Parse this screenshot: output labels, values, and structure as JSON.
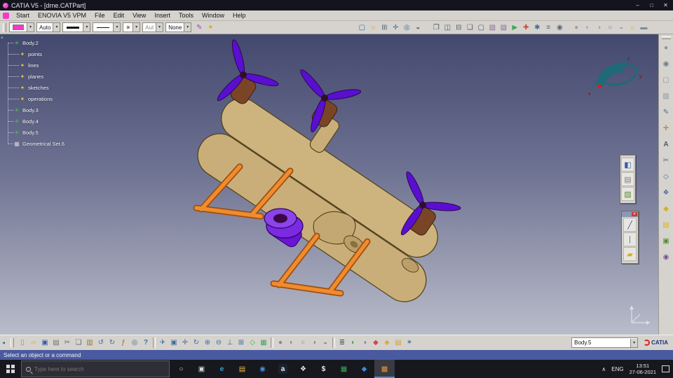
{
  "colors": {
    "accent_magenta": "#f838c8",
    "viewport_top": "#43486e",
    "viewport_bottom": "#b9bcc9",
    "model_body_tan": "#cdb37e",
    "model_propeller_purple": "#5a0fd0",
    "model_motor_brown": "#7a4526",
    "model_center_purple": "#7a2ae0",
    "model_skid_orange": "#ef8c2e",
    "compass_teal": "#1d6b79",
    "status_bar_blue": "#4a5aa0",
    "taskbar_dark": "#17181d"
  },
  "window": {
    "title": "CATIA V5 - [drne.CATPart]",
    "buttons": [
      {
        "name": "minimize-button",
        "glyph": "–"
      },
      {
        "name": "maximize-button",
        "glyph": "□"
      },
      {
        "name": "close-button",
        "glyph": "✕"
      }
    ]
  },
  "ui": {
    "drop_arrow": "▾",
    "overflow_left": "◂",
    "tree_scroll_up": "▴",
    "tray_chevron": "∧"
  },
  "menubar": {
    "items": [
      {
        "name": "menu-start",
        "label": "Start"
      },
      {
        "name": "menu-enovia",
        "label": "ENOVIA V5 VPM"
      },
      {
        "name": "menu-file",
        "label": "File"
      },
      {
        "name": "menu-edit",
        "label": "Edit"
      },
      {
        "name": "menu-view",
        "label": "View"
      },
      {
        "name": "menu-insert",
        "label": "Insert"
      },
      {
        "name": "menu-tools",
        "label": "Tools"
      },
      {
        "name": "menu-window",
        "label": "Window"
      },
      {
        "name": "menu-help",
        "label": "Help"
      }
    ]
  },
  "props_toolbar": {
    "opacity": "Auto",
    "point_symbol": "✳",
    "render_style": "Aut",
    "layer": "None"
  },
  "toolbars": {
    "controls_icons": [
      {
        "name": "painter-icon",
        "glyph": "✎",
        "style": "color:#b03ac8"
      },
      {
        "name": "wizard-icon",
        "glyph": "✶",
        "style": "color:#d8a020"
      }
    ],
    "top_b": [
      {
        "name": "camera-icon",
        "glyph": "▢",
        "style": "color:#3a6ea5"
      },
      {
        "name": "light-icon",
        "glyph": "☼",
        "style": "color:#d8a020"
      },
      {
        "name": "grid-icon",
        "glyph": "⊞",
        "style": "color:#56687a"
      },
      {
        "name": "snap-icon",
        "glyph": "✛",
        "style": "color:#3a6ea5"
      },
      {
        "name": "magnifier-icon",
        "glyph": "◎",
        "style": "color:#3a6ea5"
      },
      {
        "name": "depth-effect-icon",
        "glyph": "◒",
        "style": "color:#56687a"
      }
    ],
    "top_c": [
      {
        "name": "new-window-icon",
        "glyph": "❐",
        "style": "color:#4a5a6a"
      },
      {
        "name": "tile-horizontal-icon",
        "glyph": "◫",
        "style": "color:#4a5a6a"
      },
      {
        "name": "tile-vertical-icon",
        "glyph": "⊟",
        "style": "color:#4a5a6a"
      },
      {
        "name": "cascade-icon",
        "glyph": "❏",
        "style": "color:#4a5a6a"
      },
      {
        "name": "full-screen-icon",
        "glyph": "▢",
        "style": "color:#4a5a6a"
      },
      {
        "name": "capture-icon",
        "glyph": "▧",
        "style": "color:#8a6d9a"
      },
      {
        "name": "album-icon",
        "glyph": "▨",
        "style": "color:#8a6d9a"
      },
      {
        "name": "macro-play-icon",
        "glyph": "▶",
        "style": "color:#3aa85a"
      },
      {
        "name": "customize-icon",
        "glyph": "✚",
        "style": "color:#c84a3a"
      },
      {
        "name": "options-icon",
        "glyph": "✱",
        "style": "color:#3a6ea5"
      },
      {
        "name": "standards-icon",
        "glyph": "≡",
        "style": "color:#56687a"
      },
      {
        "name": "visualization-icon",
        "glyph": "◉",
        "style": "color:#56687a"
      }
    ],
    "top_d": [
      {
        "name": "shading-icon",
        "glyph": "●",
        "style": "color:#95a2b5"
      },
      {
        "name": "shading-edges-icon",
        "glyph": "◐",
        "style": "color:#95a2b5"
      },
      {
        "name": "shading-hidden-edges-icon",
        "glyph": "◑",
        "style": "color:#95a2b5"
      },
      {
        "name": "wireframe-icon",
        "glyph": "○",
        "style": "color:#6a7a90"
      },
      {
        "name": "custom-view-mode-icon",
        "glyph": "◒",
        "style": "color:#95a2b5"
      },
      {
        "name": "lighting-icon",
        "glyph": "☼",
        "style": "color:#d8b020"
      },
      {
        "name": "ground-icon",
        "glyph": "▬",
        "style": "color:#7a8a9a"
      }
    ],
    "right_col": [
      {
        "name": "part-body-icon",
        "glyph": "●",
        "style": "color:#8a929c"
      },
      {
        "name": "sphere-tool-icon",
        "glyph": "◉",
        "style": "color:#6a7a8a"
      },
      {
        "name": "pad-icon",
        "glyph": "▢",
        "style": "color:#8a929c"
      },
      {
        "name": "pocket-icon",
        "glyph": "▥",
        "style": "color:#8a929c"
      },
      {
        "name": "sketcher-icon",
        "glyph": "✎",
        "style": "color:#4a6a9a"
      },
      {
        "name": "measure-icon",
        "glyph": "✛",
        "style": "color:#9a7a2a"
      },
      {
        "name": "annotation-icon",
        "glyph": "A",
        "style": "color:#4a5a6a;font-weight:bold"
      },
      {
        "name": "trim-icon",
        "glyph": "✂",
        "style": "color:#5a6a7a"
      },
      {
        "name": "plane-icon",
        "glyph": "◇",
        "style": "color:#4a6a9a"
      },
      {
        "name": "pattern-icon",
        "glyph": "❖",
        "style": "color:#4a6a9a"
      },
      {
        "name": "apply-material-icon",
        "glyph": "◆",
        "style": "color:#d8b020"
      },
      {
        "name": "catalog-icon",
        "glyph": "▤",
        "style": "color:#d8b020"
      },
      {
        "name": "render-tool-icon",
        "glyph": "▣",
        "style": "color:#5a8a3a"
      },
      {
        "name": "camera-tool-icon",
        "glyph": "◉",
        "style": "color:#7a4a9a"
      }
    ],
    "panel_a": [
      {
        "name": "panel-view-icon",
        "glyph": "◧",
        "style": "color:#3a5aa8"
      },
      {
        "name": "panel-sheet-icon",
        "glyph": "▤",
        "style": "color:#7a828a"
      },
      {
        "name": "panel-image-icon",
        "glyph": "▨",
        "style": "color:#5a8a3a"
      }
    ],
    "panel_b": [
      {
        "name": "line-tool-icon",
        "glyph": "╱",
        "style": "color:#3a5aa8"
      },
      {
        "name": "axis-tool-icon",
        "glyph": "|",
        "style": "color:#6a727a"
      },
      {
        "name": "plane-tool-icon",
        "glyph": "▰",
        "style": "color:#d8b020"
      }
    ],
    "bottom_a": [
      {
        "name": "new-document-icon",
        "glyph": "▯",
        "style": "color:#8a929a"
      },
      {
        "name": "open-icon",
        "glyph": "▱",
        "style": "color:#d8a838"
      },
      {
        "name": "save-icon",
        "glyph": "▣",
        "style": "color:#3a5aa8"
      },
      {
        "name": "print-icon",
        "glyph": "▤",
        "style": "color:#6a727a"
      },
      {
        "name": "cut-icon",
        "glyph": "✂",
        "style": "color:#5a6a7a"
      },
      {
        "name": "copy-icon",
        "glyph": "❏",
        "style": "color:#5a6a7a"
      },
      {
        "name": "paste-icon",
        "glyph": "▥",
        "style": "color:#8a7a3a"
      },
      {
        "name": "undo-icon",
        "glyph": "↺",
        "style": "color:#3a6ea5"
      },
      {
        "name": "redo-icon",
        "glyph": "↻",
        "style": "color:#3a6ea5"
      },
      {
        "name": "formula-icon",
        "glyph": "ƒ",
        "style": "color:#8a6d1f"
      },
      {
        "name": "search-icon",
        "glyph": "◎",
        "style": "color:#3a6ea5"
      },
      {
        "name": "help-icon",
        "glyph": "?",
        "style": "color:#3a6ea5;font-weight:bold"
      }
    ],
    "bottom_b": [
      {
        "name": "fly-mode-icon",
        "glyph": "✈",
        "style": "color:#3a6ea5"
      },
      {
        "name": "fit-all-icon",
        "glyph": "▣",
        "style": "color:#3a6ea5"
      },
      {
        "name": "pan-icon",
        "glyph": "✛",
        "style": "color:#3a6ea5"
      },
      {
        "name": "rotate-icon",
        "glyph": "↻",
        "style": "color:#3a6ea5"
      },
      {
        "name": "zoom-in-icon",
        "glyph": "⊕",
        "style": "color:#3a6ea5"
      },
      {
        "name": "zoom-out-icon",
        "glyph": "⊖",
        "style": "color:#3a6ea5"
      },
      {
        "name": "normal-view-icon",
        "glyph": "⊥",
        "style": "color:#3a6ea5"
      },
      {
        "name": "multi-view-icon",
        "glyph": "⊞",
        "style": "color:#3a6ea5"
      },
      {
        "name": "quick-view-icon",
        "glyph": "◇",
        "style": "color:#3aa85a"
      },
      {
        "name": "named-views-icon",
        "glyph": "▦",
        "style": "color:#3aa85a"
      }
    ],
    "bottom_c": [
      {
        "name": "shading-view-icon",
        "glyph": "●",
        "style": "color:#7a8aa0"
      },
      {
        "name": "shading-edges-view-icon",
        "glyph": "◐",
        "style": "color:#7a8aa0"
      },
      {
        "name": "wireframe-view-icon",
        "glyph": "○",
        "style": "color:#7a8aa0"
      },
      {
        "name": "hidden-line-view-icon",
        "glyph": "◑",
        "style": "color:#7a8aa0"
      },
      {
        "name": "material-view-icon",
        "glyph": "◒",
        "style": "color:#7a8aa0"
      }
    ],
    "bottom_d": [
      {
        "name": "graph-tree-icon",
        "glyph": "≣",
        "style": "color:#4a5a6a"
      },
      {
        "name": "hide-show-icon",
        "glyph": "◐",
        "style": "color:#3aa85a"
      },
      {
        "name": "swap-visible-space-icon",
        "glyph": "◑",
        "style": "color:#8a6dc8"
      },
      {
        "name": "datum-icon",
        "glyph": "◆",
        "style": "color:#c84a4a"
      },
      {
        "name": "lock-update-icon",
        "glyph": "◈",
        "style": "color:#d8a020"
      },
      {
        "name": "catalog-browser-icon",
        "glyph": "▤",
        "style": "color:#d8a020"
      },
      {
        "name": "knowledge-icon",
        "glyph": "✶",
        "style": "color:#3a6ea5"
      }
    ],
    "active_body": "Body.5",
    "brand": "CATIA"
  },
  "tree": {
    "items": [
      {
        "name": "tree-item-body-2",
        "label": "Body.2",
        "glyph": "✳",
        "style": "color:#45c84f",
        "depth": 1
      },
      {
        "name": "tree-item-points",
        "label": "points",
        "glyph": "✦",
        "style": "color:#e8c24a",
        "depth": 2
      },
      {
        "name": "tree-item-lines",
        "label": "lines",
        "glyph": "✦",
        "style": "color:#e8c24a",
        "depth": 2
      },
      {
        "name": "tree-item-planes",
        "label": "planes",
        "glyph": "✦",
        "style": "color:#e8c24a",
        "depth": 2
      },
      {
        "name": "tree-item-sketches",
        "label": "sketches",
        "glyph": "✦",
        "style": "color:#e8c24a",
        "depth": 2
      },
      {
        "name": "tree-item-operations",
        "label": "operations",
        "glyph": "✦",
        "style": "color:#e8c24a",
        "depth": 2
      },
      {
        "name": "tree-item-body-3",
        "label": "Body.3",
        "glyph": "✳",
        "style": "color:#45c84f",
        "depth": 1
      },
      {
        "name": "tree-item-body-4",
        "label": "Body.4",
        "glyph": "✳",
        "style": "color:#45c84f",
        "depth": 1
      },
      {
        "name": "tree-item-body-5",
        "label": "Body.5",
        "glyph": "✳",
        "style": "color:#45c84f",
        "depth": 1
      },
      {
        "name": "tree-item-geometrical-set-6",
        "label": "Geometrical Set.6",
        "glyph": "▦",
        "style": "color:#cdd1da",
        "depth": 1
      }
    ]
  },
  "compass": {
    "axis_x": "x",
    "axis_y": "y",
    "axis_z": "z"
  },
  "statusbar": {
    "message": "Select an object or a command"
  },
  "taskbar": {
    "search_placeholder": "Type here to search",
    "apps": [
      {
        "name": "taskbar-cortana",
        "glyph": "○",
        "style": "color:#cfd4dc"
      },
      {
        "name": "taskbar-task-view",
        "glyph": "▣",
        "style": "color:#cfd4dc"
      },
      {
        "name": "taskbar-edge",
        "glyph": "e",
        "style": "color:#35a0e0;font-weight:bold"
      },
      {
        "name": "taskbar-file-explorer",
        "glyph": "▤",
        "style": "color:#e8b84a"
      },
      {
        "name": "taskbar-browser",
        "glyph": "◉",
        "style": "color:#4a90d9"
      },
      {
        "name": "taskbar-amazon",
        "glyph": "a",
        "style": "color:#f0f0f0;background:#1a2430;padding:0 3px;font-weight:bold"
      },
      {
        "name": "taskbar-dropbox",
        "glyph": "❖",
        "style": "color:#e8eaee"
      },
      {
        "name": "taskbar-payments",
        "glyph": "$",
        "style": "color:#e8eaee;font-weight:bold"
      },
      {
        "name": "taskbar-excel",
        "glyph": "▦",
        "style": "color:#3aa85a"
      },
      {
        "name": "taskbar-store",
        "glyph": "◆",
        "style": "color:#3a8ad8"
      },
      {
        "name": "taskbar-catia",
        "glyph": "▩",
        "style": "color:#e8953a",
        "active": "true"
      }
    ],
    "tray": {
      "lang": "ENG",
      "time": "13:51",
      "date": "27-06-2021"
    }
  }
}
